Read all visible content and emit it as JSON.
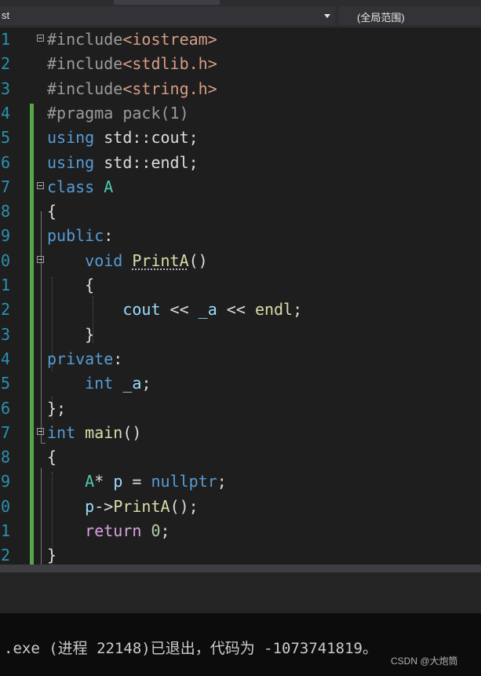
{
  "toolbar": {
    "scope_left": "st",
    "scope_right": "(全局范围)"
  },
  "editor": {
    "lines": [
      {
        "n": "1",
        "tokens": [
          {
            "t": "#include",
            "c": "pp"
          },
          {
            "t": "<iostream>",
            "c": "inc"
          }
        ]
      },
      {
        "n": "2",
        "tokens": [
          {
            "t": "#include",
            "c": "pp"
          },
          {
            "t": "<stdlib.h>",
            "c": "inc"
          }
        ]
      },
      {
        "n": "3",
        "tokens": [
          {
            "t": "#include",
            "c": "pp"
          },
          {
            "t": "<string.h>",
            "c": "inc"
          }
        ]
      },
      {
        "n": "4",
        "tokens": [
          {
            "t": "#pragma pack(1)",
            "c": "pp"
          }
        ]
      },
      {
        "n": "5",
        "tokens": [
          {
            "t": "using",
            "c": "kw"
          },
          {
            "t": " std::cout;",
            "c": ""
          }
        ]
      },
      {
        "n": "6",
        "tokens": [
          {
            "t": "using",
            "c": "kw"
          },
          {
            "t": " std::endl;",
            "c": ""
          }
        ]
      },
      {
        "n": "7",
        "tokens": [
          {
            "t": "class",
            "c": "kw"
          },
          {
            "t": " ",
            "c": ""
          },
          {
            "t": "A",
            "c": "typ"
          }
        ]
      },
      {
        "n": "8",
        "tokens": [
          {
            "t": "{",
            "c": ""
          }
        ]
      },
      {
        "n": "9",
        "tokens": [
          {
            "t": "public",
            "c": "kw"
          },
          {
            "t": ":",
            "c": ""
          }
        ]
      },
      {
        "n": "0",
        "tokens": [
          {
            "t": "    ",
            "c": ""
          },
          {
            "t": "void",
            "c": "kw"
          },
          {
            "t": " ",
            "c": ""
          },
          {
            "t": "PrintA",
            "c": "fn squig"
          },
          {
            "t": "()",
            "c": ""
          }
        ]
      },
      {
        "n": "1",
        "tokens": [
          {
            "t": "    {",
            "c": ""
          }
        ]
      },
      {
        "n": "2",
        "tokens": [
          {
            "t": "        ",
            "c": ""
          },
          {
            "t": "cout",
            "c": "id"
          },
          {
            "t": " << ",
            "c": ""
          },
          {
            "t": "_a",
            "c": "id"
          },
          {
            "t": " << ",
            "c": ""
          },
          {
            "t": "endl",
            "c": "fn"
          },
          {
            "t": ";",
            "c": ""
          }
        ]
      },
      {
        "n": "3",
        "tokens": [
          {
            "t": "    }",
            "c": ""
          }
        ]
      },
      {
        "n": "4",
        "tokens": [
          {
            "t": "private",
            "c": "kw"
          },
          {
            "t": ":",
            "c": ""
          }
        ]
      },
      {
        "n": "5",
        "tokens": [
          {
            "t": "    ",
            "c": ""
          },
          {
            "t": "int",
            "c": "kw"
          },
          {
            "t": " ",
            "c": ""
          },
          {
            "t": "_a",
            "c": "id"
          },
          {
            "t": ";",
            "c": ""
          }
        ]
      },
      {
        "n": "6",
        "tokens": [
          {
            "t": "};",
            "c": ""
          }
        ]
      },
      {
        "n": "7",
        "tokens": [
          {
            "t": "int",
            "c": "kw"
          },
          {
            "t": " ",
            "c": ""
          },
          {
            "t": "main",
            "c": "fn"
          },
          {
            "t": "()",
            "c": ""
          }
        ]
      },
      {
        "n": "8",
        "tokens": [
          {
            "t": "{",
            "c": ""
          }
        ]
      },
      {
        "n": "9",
        "tokens": [
          {
            "t": "    ",
            "c": ""
          },
          {
            "t": "A",
            "c": "typ"
          },
          {
            "t": "* ",
            "c": ""
          },
          {
            "t": "p",
            "c": "id"
          },
          {
            "t": " = ",
            "c": ""
          },
          {
            "t": "nullptr",
            "c": "kw"
          },
          {
            "t": ";",
            "c": ""
          }
        ]
      },
      {
        "n": "0",
        "tokens": [
          {
            "t": "    ",
            "c": ""
          },
          {
            "t": "p",
            "c": "id"
          },
          {
            "t": "->",
            "c": ""
          },
          {
            "t": "PrintA",
            "c": "fn"
          },
          {
            "t": "();",
            "c": ""
          }
        ]
      },
      {
        "n": "1",
        "tokens": [
          {
            "t": "    ",
            "c": ""
          },
          {
            "t": "return",
            "c": "ctl"
          },
          {
            "t": " ",
            "c": ""
          },
          {
            "t": "0",
            "c": "num"
          },
          {
            "t": ";",
            "c": ""
          }
        ]
      },
      {
        "n": "2",
        "tokens": [
          {
            "t": "}",
            "c": ""
          }
        ]
      }
    ]
  },
  "console": {
    "text": ".exe (进程 22148)已退出，代码为 -1073741819。"
  },
  "watermark": "CSDN @大炮筒"
}
